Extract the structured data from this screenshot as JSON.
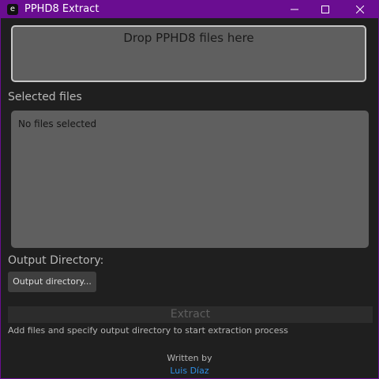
{
  "window": {
    "title": "PPHD8 Extract",
    "app_icon_glyph": "e"
  },
  "dropzone": {
    "label": "Drop PPHD8 files here"
  },
  "files": {
    "heading": "Selected files",
    "empty_text": "No files selected"
  },
  "output": {
    "heading": "Output Directory:",
    "button_label": "Output directory..."
  },
  "actions": {
    "extract_label": "Extract",
    "status": "Add files and specify output directory to start extraction process"
  },
  "credits": {
    "written_by": "Written by",
    "author": "Luis Díaz"
  },
  "colors": {
    "titlebar": "#6a0d91",
    "background": "#1f1f1f",
    "panel": "#5f5f5f",
    "link": "#2f8fe6"
  }
}
